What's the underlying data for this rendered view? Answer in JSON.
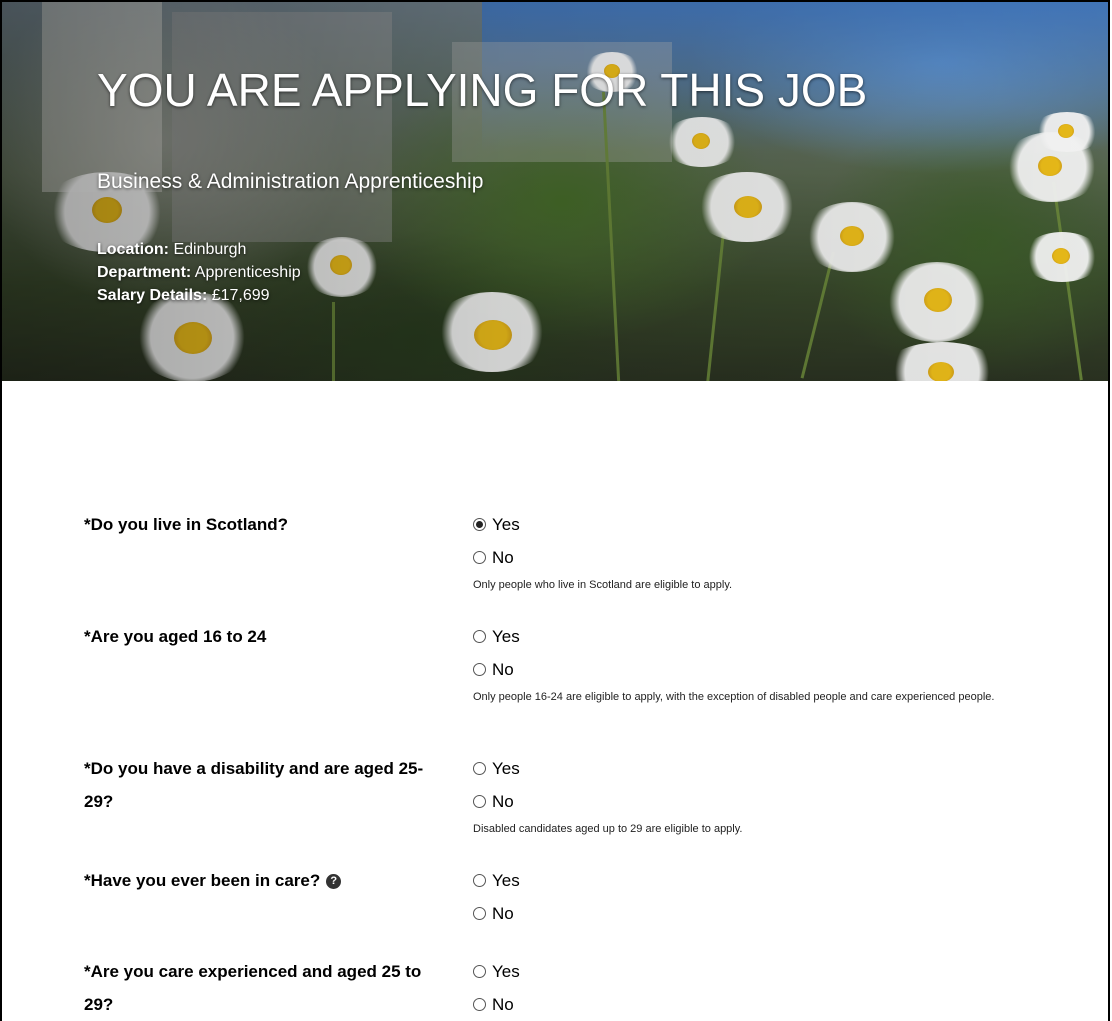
{
  "header": {
    "title": "YOU ARE APPLYING FOR THIS JOB",
    "job_title": "Business & Administration Apprenticeship",
    "location_label": "Location:",
    "location_value": "Edinburgh",
    "department_label": "Department:",
    "department_value": "Apprenticeship",
    "salary_label": "Salary Details:",
    "salary_value": "£17,699"
  },
  "questions": [
    {
      "label": "*Do you live in Scotland?",
      "options": [
        "Yes",
        "No"
      ],
      "selected": "Yes",
      "note": "Only people who live in Scotland are eligible to apply."
    },
    {
      "label": "*Are you aged 16 to 24",
      "options": [
        "Yes",
        "No"
      ],
      "selected": null,
      "note": "Only people 16-24 are eligible to apply, with the exception of disabled people and care experienced people."
    },
    {
      "label": "*Do you have a disability and are aged 25-29?",
      "options": [
        "Yes",
        "No"
      ],
      "selected": null,
      "note": "Disabled candidates aged up to 29 are eligible to apply."
    },
    {
      "label": "*Have you ever been in care?",
      "options": [
        "Yes",
        "No"
      ],
      "selected": null,
      "help_icon": "question-circle-icon",
      "note": ""
    },
    {
      "label": "*Are you care experienced and aged 25 to 29?",
      "options": [
        "Yes",
        "No"
      ],
      "selected": null,
      "note": ""
    }
  ],
  "help_glyph": "?"
}
